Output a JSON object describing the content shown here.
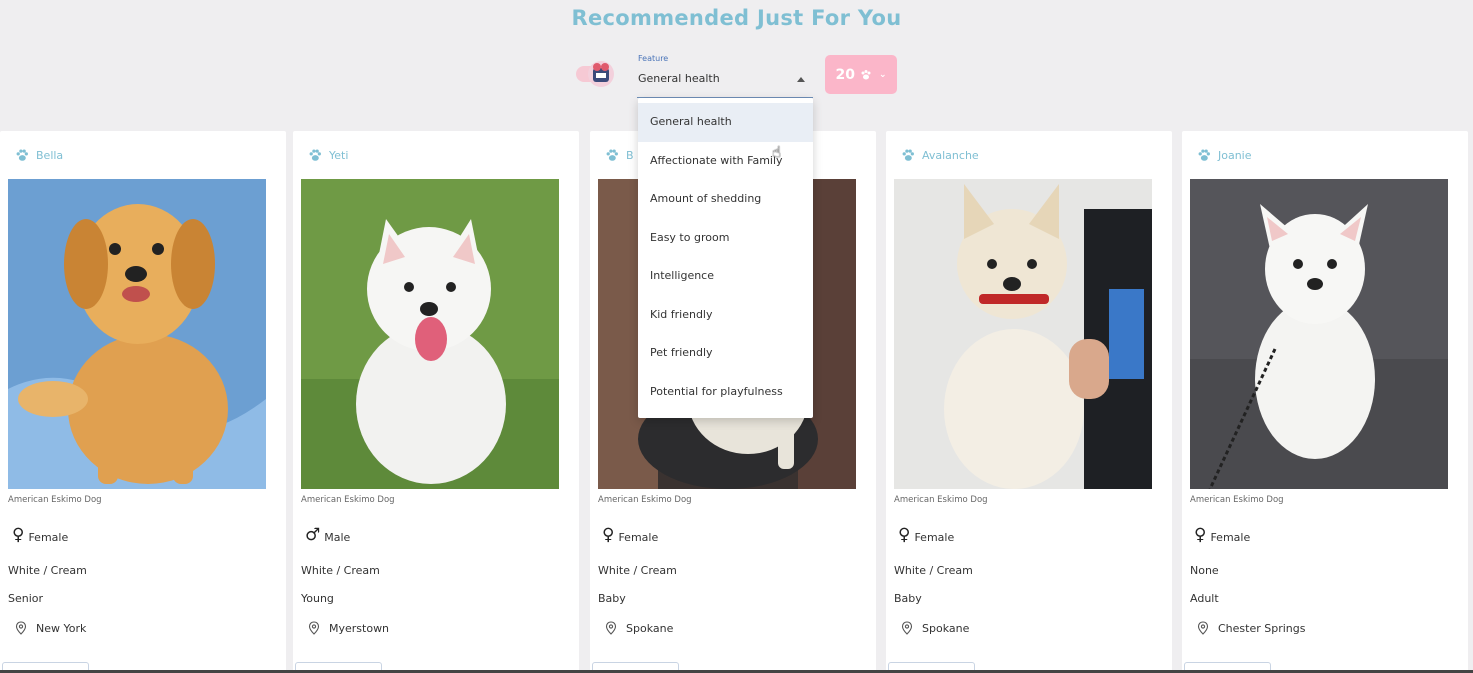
{
  "header": {
    "title": "Recommended Just For You"
  },
  "filter": {
    "label": "Feature",
    "selected": "General health",
    "count_label": "20",
    "options": [
      "General health",
      "Affectionate with Family",
      "Amount of shedding",
      "Easy to groom",
      "Intelligence",
      "Kid friendly",
      "Pet friendly",
      "Potential for playfulness"
    ]
  },
  "cards": [
    {
      "name": "Bella",
      "breed": "American Eskimo Dog",
      "gender": "Female",
      "color": "White / Cream",
      "age": "Senior",
      "location": "New York"
    },
    {
      "name": "Yeti",
      "breed": "American Eskimo Dog",
      "gender": "Male",
      "color": "White / Cream",
      "age": "Young",
      "location": "Myerstown"
    },
    {
      "name": "B",
      "breed": "American Eskimo Dog",
      "gender": "Female",
      "color": "White / Cream",
      "age": "Baby",
      "location": "Spokane"
    },
    {
      "name": "Avalanche",
      "breed": "American Eskimo Dog",
      "gender": "Female",
      "color": "White / Cream",
      "age": "Baby",
      "location": "Spokane"
    },
    {
      "name": "Joanie",
      "breed": "American Eskimo Dog",
      "gender": "Female",
      "color": "None",
      "age": "Adult",
      "location": "Chester Springs"
    }
  ],
  "colors": {
    "accent": "#7fbfd3",
    "pink": "#fbb6c9",
    "page_bg": "#efeef0"
  },
  "icons": {
    "paw": "paw-icon",
    "female": "female-icon",
    "male": "male-icon",
    "location": "location-pin-icon"
  }
}
